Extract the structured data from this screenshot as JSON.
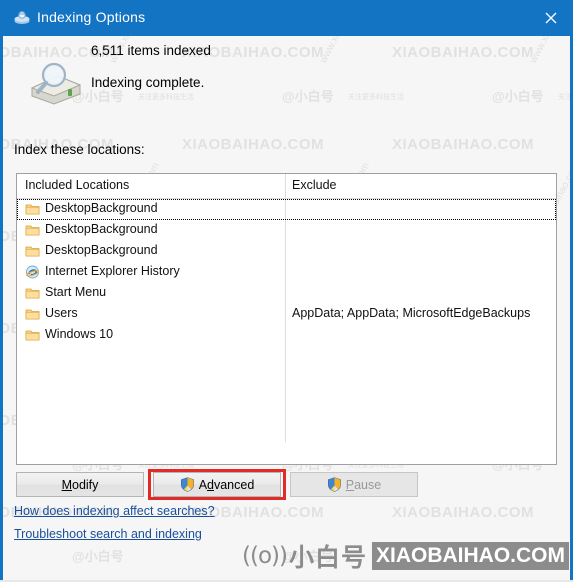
{
  "window": {
    "title": "Indexing Options",
    "icon": "indexing-options-icon",
    "close_label": "✕",
    "titlebar_color": "#1474c4"
  },
  "status": {
    "items_indexed": "6,511 items indexed",
    "indexing_state": "Indexing complete.",
    "icon": "search-drive-icon"
  },
  "locations": {
    "label": "Index these locations:",
    "columns": [
      "Included Locations",
      "Exclude"
    ],
    "rows": [
      {
        "icon": "folder-icon",
        "name": "DesktopBackground",
        "exclude": "",
        "focused": true
      },
      {
        "icon": "folder-icon",
        "name": "DesktopBackground",
        "exclude": "",
        "focused": false
      },
      {
        "icon": "folder-icon",
        "name": "DesktopBackground",
        "exclude": "",
        "focused": false
      },
      {
        "icon": "internet-explorer-icon",
        "name": "Internet Explorer History",
        "exclude": "",
        "focused": false
      },
      {
        "icon": "folder-icon",
        "name": "Start Menu",
        "exclude": "",
        "focused": false
      },
      {
        "icon": "folder-icon",
        "name": "Users",
        "exclude": "AppData; AppData; MicrosoftEdgeBackups",
        "focused": false
      },
      {
        "icon": "folder-icon",
        "name": "Windows 10",
        "exclude": "",
        "focused": false
      }
    ]
  },
  "buttons": {
    "modify": {
      "label": "Modify",
      "accel": "M",
      "shield": false,
      "disabled": false
    },
    "advanced": {
      "label": "Advanced",
      "accel": "d",
      "shield": true,
      "disabled": false,
      "highlight_color": "#e22b26"
    },
    "pause": {
      "label": "Pause",
      "accel": "P",
      "shield": true,
      "disabled": true
    }
  },
  "links": [
    "How does indexing affect searches?",
    "Troubleshoot search and indexing"
  ],
  "brand": {
    "wave": "((o))",
    "cn": "小白号",
    "domain": "XIAOBAIHAO.COM"
  },
  "watermarks": {
    "domain": "XIAOBAIHAO.COM",
    "cn": "@小白号",
    "cn_small": "关注更多科技生活",
    "rot": "www.xiaobaihao.com"
  }
}
